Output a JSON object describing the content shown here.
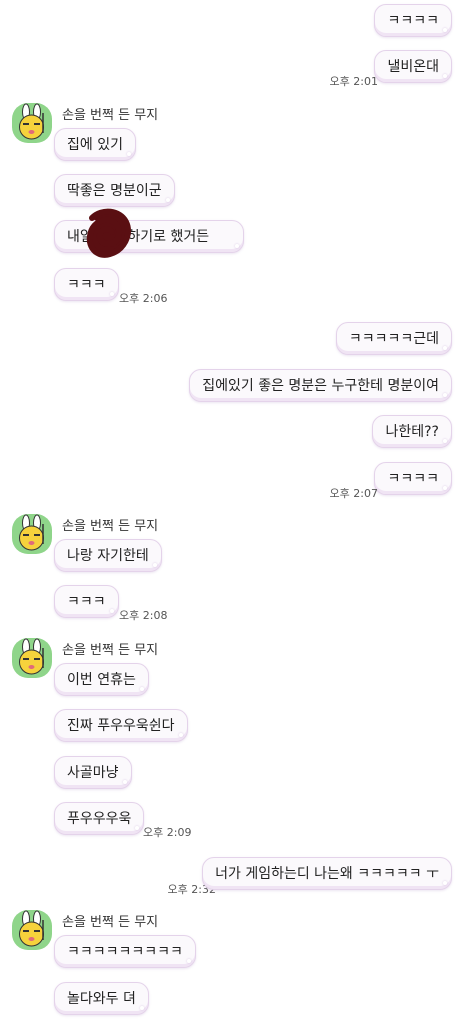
{
  "sender_name": "손을 번쩍 든 무지",
  "messages": {
    "m1": "ㅋㅋㅋㅋ",
    "m2": "낼비온대",
    "m3": "집에 있기",
    "m4": "딱좋은 명분이군",
    "m5": "내일 랑 롤하기로 했거든",
    "m6": "ㅋㅋㅋ",
    "m7": "ㅋㅋㅋㅋㅋ근데",
    "m8": "집에있기 좋은 명분은 누구한테 명분이여",
    "m9": "나한테??",
    "m10": "ㅋㅋㅋㅋ",
    "m11": "나랑 자기한테",
    "m12": "ㅋㅋㅋ",
    "m13": "이번 연휴는",
    "m14": "진짜 푸우우욱쉰다",
    "m15": "사골마냥",
    "m16": "푸우우우욱",
    "m17": "너가 게임하는디 나는왜 ㅋㅋㅋㅋㅋ ㅜ",
    "m18": "ㅋㅋㅋㅋㅋㅋㅋㅋㅋ",
    "m19": "놀다와두 뎌"
  },
  "times": {
    "t1": "오후 2:01",
    "t2": "오후 2:06",
    "t3": "오후 2:07",
    "t4": "오후 2:08",
    "t5": "오후 2:09",
    "t6": "오후 2:32"
  },
  "colors": {
    "bubble_bg": "#fbf9fc",
    "bubble_border": "#e4d3ea",
    "avatar_bg": "#8fd58a",
    "character_yellow": "#f6d23c",
    "redaction": "#5a0f12"
  },
  "icons": {
    "avatar": "muzi-character-icon"
  }
}
